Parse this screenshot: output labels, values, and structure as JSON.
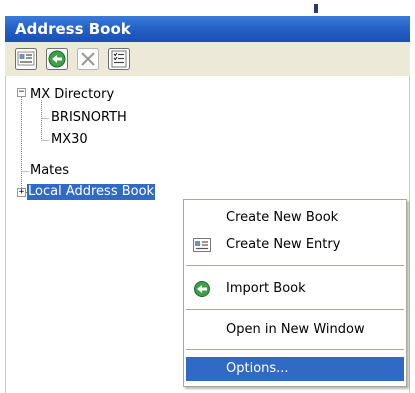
{
  "window": {
    "title": "Address Book"
  },
  "toolbar": {
    "buttons": [
      {
        "icon": "address-card-icon"
      },
      {
        "icon": "import-arrow-icon"
      },
      {
        "icon": "delete-x-icon"
      },
      {
        "icon": "properties-list-icon"
      }
    ]
  },
  "tree": {
    "mx_directory": "MX Directory",
    "brisnorth": "BRISNORTH",
    "mx30": "MX30",
    "mates": "Mates",
    "local_address_book": "Local Address Book"
  },
  "context_menu": {
    "create_new_book": "Create New Book",
    "create_new_entry": "Create New Entry",
    "import_book": "Import Book",
    "open_in_new_window": "Open in New Window",
    "options": "Options..."
  },
  "colors": {
    "titlebar": "#2460c6",
    "selection": "#316ac5",
    "toolbar": "#ece9d8"
  }
}
